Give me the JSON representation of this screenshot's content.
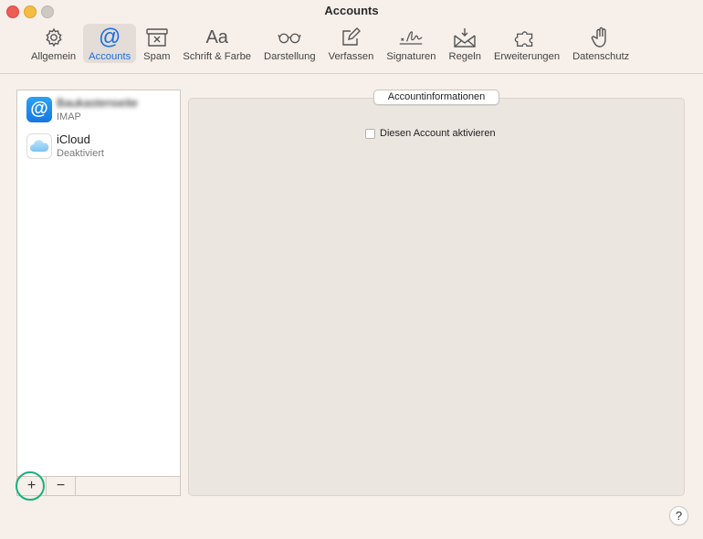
{
  "window": {
    "title": "Accounts"
  },
  "toolbar": {
    "items": [
      {
        "label": "Allgemein",
        "icon": "gear-icon"
      },
      {
        "label": "Accounts",
        "icon": "at-icon",
        "active": true
      },
      {
        "label": "Spam",
        "icon": "junk-icon"
      },
      {
        "label": "Schrift & Farbe",
        "icon": "font-icon",
        "glyph": "Aa"
      },
      {
        "label": "Darstellung",
        "icon": "glasses-icon"
      },
      {
        "label": "Verfassen",
        "icon": "compose-icon"
      },
      {
        "label": "Signaturen",
        "icon": "signature-icon"
      },
      {
        "label": "Regeln",
        "icon": "rules-icon"
      },
      {
        "label": "Erweiterungen",
        "icon": "puzzle-icon"
      },
      {
        "label": "Datenschutz",
        "icon": "hand-icon"
      }
    ]
  },
  "accounts": [
    {
      "name": "Baukastenseite",
      "type": "IMAP",
      "icon": "at-icon",
      "blurred": true
    },
    {
      "name": "iCloud",
      "type": "Deaktiviert",
      "icon": "cloud-icon"
    }
  ],
  "list_footer": {
    "add": "+",
    "remove": "−"
  },
  "panel": {
    "tab_label": "Accountinformationen",
    "checkbox_label": "Diesen Account aktivieren",
    "checkbox_checked": false
  },
  "help": {
    "label": "?"
  },
  "colors": {
    "accent": "#1a6fe0",
    "highlight": "#19b07c",
    "close": "#ee5d55",
    "minimize": "#f5bd3f"
  }
}
